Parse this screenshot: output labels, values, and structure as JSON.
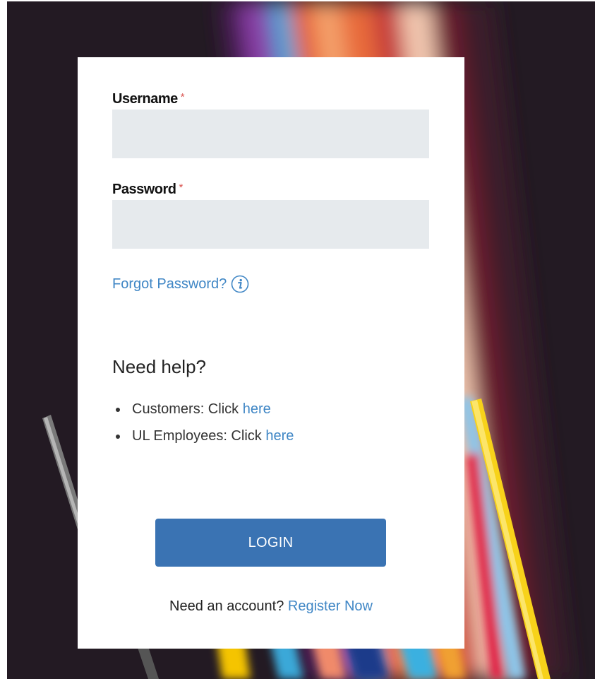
{
  "form": {
    "username": {
      "label": "Username",
      "required_mark": "*",
      "value": "",
      "placeholder": ""
    },
    "password": {
      "label": "Password",
      "required_mark": "*",
      "value": "",
      "placeholder": ""
    },
    "forgot_password_label": "Forgot Password?",
    "forgot_password_icon": "info-icon"
  },
  "help": {
    "heading": "Need help?",
    "items": [
      {
        "prefix": "Customers: Click",
        "link_label": "here"
      },
      {
        "prefix": "UL Employees: Click",
        "link_label": "here"
      }
    ]
  },
  "actions": {
    "login_label": "LOGIN",
    "register_prompt": "Need an account?",
    "register_link_label": "Register Now"
  },
  "colors": {
    "accent": "#3f86c5",
    "button": "#3a73b3",
    "field_background": "#e6eaed",
    "required": "#d9534f",
    "background_dark": "#231a23"
  }
}
